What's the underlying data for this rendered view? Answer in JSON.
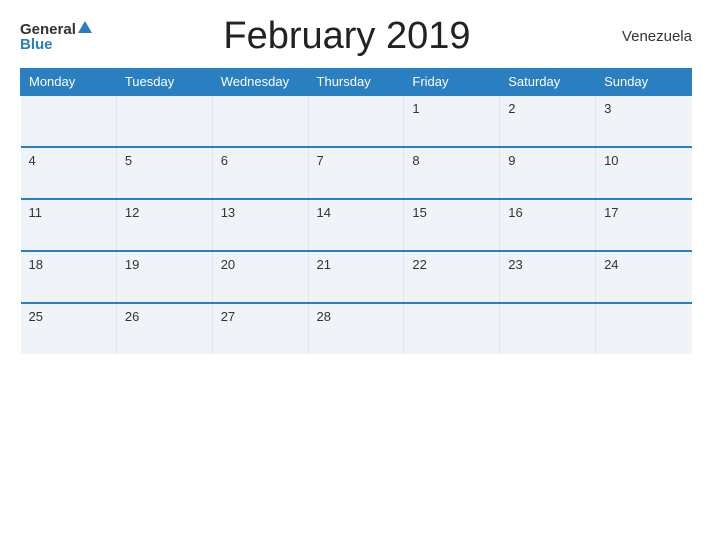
{
  "header": {
    "logo_general": "General",
    "logo_blue": "Blue",
    "title": "February 2019",
    "country": "Venezuela"
  },
  "calendar": {
    "days": [
      "Monday",
      "Tuesday",
      "Wednesday",
      "Thursday",
      "Friday",
      "Saturday",
      "Sunday"
    ],
    "weeks": [
      [
        null,
        null,
        null,
        null,
        "1",
        "2",
        "3"
      ],
      [
        "4",
        "5",
        "6",
        "7",
        "8",
        "9",
        "10"
      ],
      [
        "11",
        "12",
        "13",
        "14",
        "15",
        "16",
        "17"
      ],
      [
        "18",
        "19",
        "20",
        "21",
        "22",
        "23",
        "24"
      ],
      [
        "25",
        "26",
        "27",
        "28",
        null,
        null,
        null
      ]
    ]
  }
}
